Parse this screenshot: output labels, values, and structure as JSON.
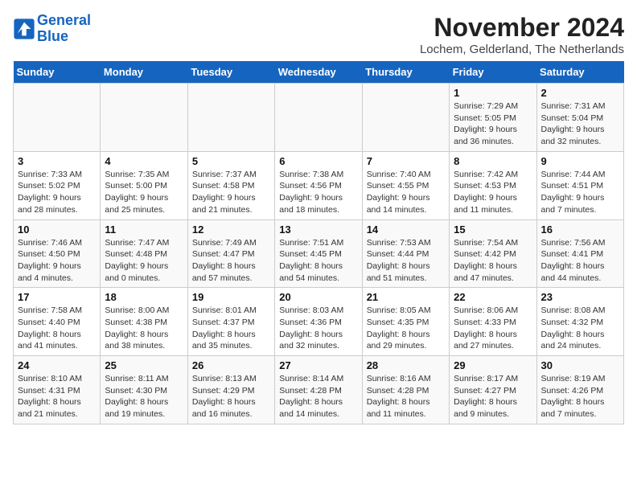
{
  "header": {
    "logo_line1": "General",
    "logo_line2": "Blue",
    "month": "November 2024",
    "location": "Lochem, Gelderland, The Netherlands"
  },
  "days_of_week": [
    "Sunday",
    "Monday",
    "Tuesday",
    "Wednesday",
    "Thursday",
    "Friday",
    "Saturday"
  ],
  "weeks": [
    [
      {
        "day": "",
        "info": ""
      },
      {
        "day": "",
        "info": ""
      },
      {
        "day": "",
        "info": ""
      },
      {
        "day": "",
        "info": ""
      },
      {
        "day": "",
        "info": ""
      },
      {
        "day": "1",
        "info": "Sunrise: 7:29 AM\nSunset: 5:05 PM\nDaylight: 9 hours and 36 minutes."
      },
      {
        "day": "2",
        "info": "Sunrise: 7:31 AM\nSunset: 5:04 PM\nDaylight: 9 hours and 32 minutes."
      }
    ],
    [
      {
        "day": "3",
        "info": "Sunrise: 7:33 AM\nSunset: 5:02 PM\nDaylight: 9 hours and 28 minutes."
      },
      {
        "day": "4",
        "info": "Sunrise: 7:35 AM\nSunset: 5:00 PM\nDaylight: 9 hours and 25 minutes."
      },
      {
        "day": "5",
        "info": "Sunrise: 7:37 AM\nSunset: 4:58 PM\nDaylight: 9 hours and 21 minutes."
      },
      {
        "day": "6",
        "info": "Sunrise: 7:38 AM\nSunset: 4:56 PM\nDaylight: 9 hours and 18 minutes."
      },
      {
        "day": "7",
        "info": "Sunrise: 7:40 AM\nSunset: 4:55 PM\nDaylight: 9 hours and 14 minutes."
      },
      {
        "day": "8",
        "info": "Sunrise: 7:42 AM\nSunset: 4:53 PM\nDaylight: 9 hours and 11 minutes."
      },
      {
        "day": "9",
        "info": "Sunrise: 7:44 AM\nSunset: 4:51 PM\nDaylight: 9 hours and 7 minutes."
      }
    ],
    [
      {
        "day": "10",
        "info": "Sunrise: 7:46 AM\nSunset: 4:50 PM\nDaylight: 9 hours and 4 minutes."
      },
      {
        "day": "11",
        "info": "Sunrise: 7:47 AM\nSunset: 4:48 PM\nDaylight: 9 hours and 0 minutes."
      },
      {
        "day": "12",
        "info": "Sunrise: 7:49 AM\nSunset: 4:47 PM\nDaylight: 8 hours and 57 minutes."
      },
      {
        "day": "13",
        "info": "Sunrise: 7:51 AM\nSunset: 4:45 PM\nDaylight: 8 hours and 54 minutes."
      },
      {
        "day": "14",
        "info": "Sunrise: 7:53 AM\nSunset: 4:44 PM\nDaylight: 8 hours and 51 minutes."
      },
      {
        "day": "15",
        "info": "Sunrise: 7:54 AM\nSunset: 4:42 PM\nDaylight: 8 hours and 47 minutes."
      },
      {
        "day": "16",
        "info": "Sunrise: 7:56 AM\nSunset: 4:41 PM\nDaylight: 8 hours and 44 minutes."
      }
    ],
    [
      {
        "day": "17",
        "info": "Sunrise: 7:58 AM\nSunset: 4:40 PM\nDaylight: 8 hours and 41 minutes."
      },
      {
        "day": "18",
        "info": "Sunrise: 8:00 AM\nSunset: 4:38 PM\nDaylight: 8 hours and 38 minutes."
      },
      {
        "day": "19",
        "info": "Sunrise: 8:01 AM\nSunset: 4:37 PM\nDaylight: 8 hours and 35 minutes."
      },
      {
        "day": "20",
        "info": "Sunrise: 8:03 AM\nSunset: 4:36 PM\nDaylight: 8 hours and 32 minutes."
      },
      {
        "day": "21",
        "info": "Sunrise: 8:05 AM\nSunset: 4:35 PM\nDaylight: 8 hours and 29 minutes."
      },
      {
        "day": "22",
        "info": "Sunrise: 8:06 AM\nSunset: 4:33 PM\nDaylight: 8 hours and 27 minutes."
      },
      {
        "day": "23",
        "info": "Sunrise: 8:08 AM\nSunset: 4:32 PM\nDaylight: 8 hours and 24 minutes."
      }
    ],
    [
      {
        "day": "24",
        "info": "Sunrise: 8:10 AM\nSunset: 4:31 PM\nDaylight: 8 hours and 21 minutes."
      },
      {
        "day": "25",
        "info": "Sunrise: 8:11 AM\nSunset: 4:30 PM\nDaylight: 8 hours and 19 minutes."
      },
      {
        "day": "26",
        "info": "Sunrise: 8:13 AM\nSunset: 4:29 PM\nDaylight: 8 hours and 16 minutes."
      },
      {
        "day": "27",
        "info": "Sunrise: 8:14 AM\nSunset: 4:28 PM\nDaylight: 8 hours and 14 minutes."
      },
      {
        "day": "28",
        "info": "Sunrise: 8:16 AM\nSunset: 4:28 PM\nDaylight: 8 hours and 11 minutes."
      },
      {
        "day": "29",
        "info": "Sunrise: 8:17 AM\nSunset: 4:27 PM\nDaylight: 8 hours and 9 minutes."
      },
      {
        "day": "30",
        "info": "Sunrise: 8:19 AM\nSunset: 4:26 PM\nDaylight: 8 hours and 7 minutes."
      }
    ]
  ]
}
